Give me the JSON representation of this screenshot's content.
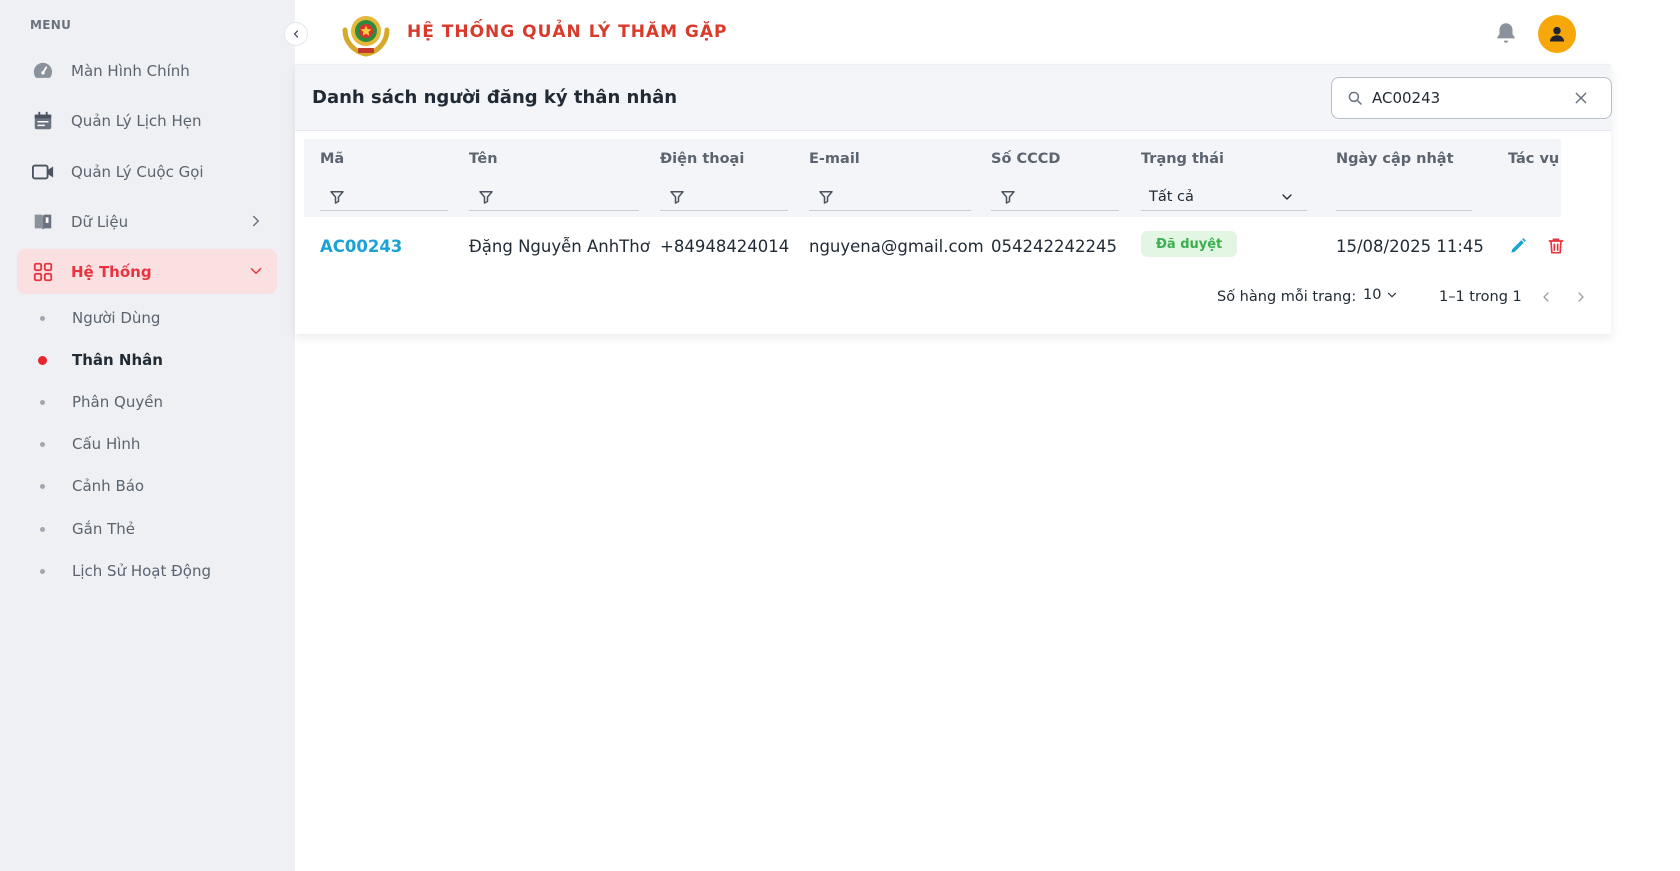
{
  "sidebar": {
    "menu_title": "MENU",
    "items": [
      {
        "label": "Màn Hình Chính",
        "icon": "dashboard-icon"
      },
      {
        "label": "Quản Lý Lịch Hẹn",
        "icon": "calendar-icon"
      },
      {
        "label": "Quản Lý Cuộc Gọi",
        "icon": "video-camera-icon"
      },
      {
        "label": "Dữ Liệu",
        "icon": "book-icon"
      },
      {
        "label": "Hệ Thống",
        "icon": "grid-icon"
      }
    ],
    "sub_items": [
      {
        "label": "Người Dùng"
      },
      {
        "label": "Thân Nhân"
      },
      {
        "label": "Phân Quyền"
      },
      {
        "label": "Cấu Hình"
      },
      {
        "label": "Cảnh Báo"
      },
      {
        "label": "Gắn Thẻ"
      },
      {
        "label": "Lịch Sử Hoạt Động"
      }
    ],
    "active_color": "#e8343e"
  },
  "header": {
    "title": "HỆ THỐNG QUẢN LÝ THĂM GẶP",
    "title_color": "#d83a2c",
    "avatar_color": "#f6a80a"
  },
  "card": {
    "title": "Danh sách người đăng ký thân nhân",
    "search": {
      "value": "AC00243",
      "placeholder": ""
    }
  },
  "table": {
    "columns": [
      "Mã",
      "Tên",
      "Điện thoại",
      "E-mail",
      "Số CCCD",
      "Trạng thái",
      "Ngày cập nhật",
      "Tác vụ"
    ],
    "status_filter": "Tất cả",
    "rows": [
      {
        "code": "AC00243",
        "name": "Đặng Nguyễn AnhThơ",
        "phone": "+84948424014",
        "email": "nguyena@gmail.com",
        "cccd": "054242242245",
        "status": "Đã duyệt",
        "updated": "15/08/2025 11:45"
      }
    ]
  },
  "pagination": {
    "rows_per_page_label": "Số hàng mỗi trang:",
    "rows_per_page": "10",
    "range": "1–1 trong 1"
  }
}
